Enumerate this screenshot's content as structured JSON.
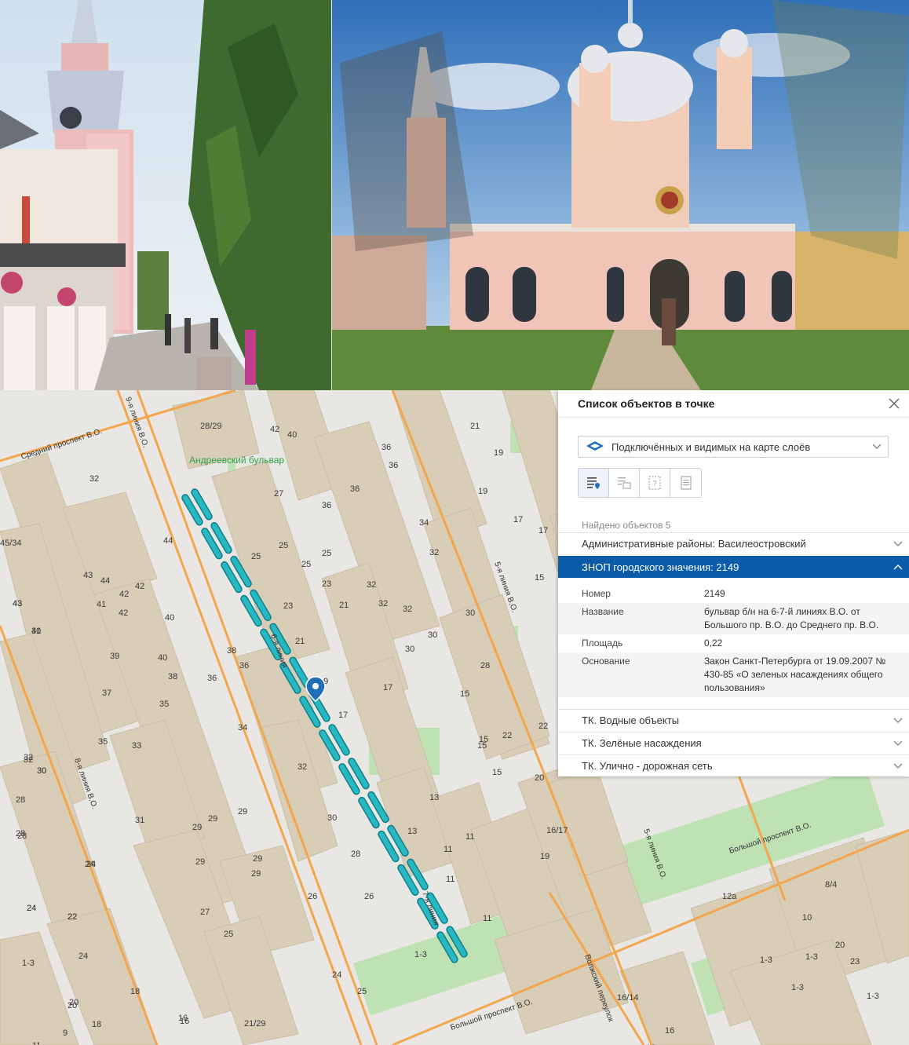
{
  "photos": {
    "left_alt": "street-photo",
    "right_alt": "cathedral-photo"
  },
  "map": {
    "park_label": "Андреевский бульвар",
    "streets": {
      "sredniy": "Средний проспект В.О.",
      "liniya9": "9-я линия В.О.",
      "liniya8": "8-я линия В.О.",
      "liniya5a": "5-я линия В.О.",
      "liniya5b": "5-я линия В.О.",
      "bolshoy1": "Большой проспект В.О.",
      "bolshoy2": "Большой проспект В.О.",
      "volzhskiy": "Волжский переулок",
      "liniya6": "6-я линия",
      "liniya7": "7-я линия"
    },
    "numbers": [
      {
        "t": "28/29"
      },
      {
        "t": "42"
      },
      {
        "t": "40"
      },
      {
        "t": "21"
      },
      {
        "t": "36"
      },
      {
        "t": "36"
      },
      {
        "t": "19"
      },
      {
        "t": "32"
      },
      {
        "t": "27"
      },
      {
        "t": "36"
      },
      {
        "t": "36"
      },
      {
        "t": "19"
      },
      {
        "t": "34"
      },
      {
        "t": "17"
      },
      {
        "t": "17"
      },
      {
        "t": "44"
      },
      {
        "t": "45/34"
      },
      {
        "t": "25"
      },
      {
        "t": "25"
      },
      {
        "t": "25"
      },
      {
        "t": "25"
      },
      {
        "t": "32"
      },
      {
        "t": "43"
      },
      {
        "t": "44"
      },
      {
        "t": "42"
      },
      {
        "t": "42"
      },
      {
        "t": "23"
      },
      {
        "t": "32"
      },
      {
        "t": "15"
      },
      {
        "t": "43"
      },
      {
        "t": "41"
      },
      {
        "t": "42"
      },
      {
        "t": "40"
      },
      {
        "t": "23"
      },
      {
        "t": "21"
      },
      {
        "t": "32"
      },
      {
        "t": "32"
      },
      {
        "t": "30"
      },
      {
        "t": "41"
      },
      {
        "t": "30"
      },
      {
        "t": "21"
      },
      {
        "t": "39"
      },
      {
        "t": "40"
      },
      {
        "t": "38"
      },
      {
        "t": "30"
      },
      {
        "t": "38"
      },
      {
        "t": "36"
      },
      {
        "t": "36"
      },
      {
        "t": "28"
      },
      {
        "t": "37"
      },
      {
        "t": "19"
      },
      {
        "t": "17"
      },
      {
        "t": "15"
      },
      {
        "t": "35"
      },
      {
        "t": "17"
      },
      {
        "t": "34"
      },
      {
        "t": "22"
      },
      {
        "t": "35"
      },
      {
        "t": "33"
      },
      {
        "t": "15"
      },
      {
        "t": "22"
      },
      {
        "t": "32"
      },
      {
        "t": "15"
      },
      {
        "t": "15"
      },
      {
        "t": "20"
      },
      {
        "t": "30"
      },
      {
        "t": "32"
      },
      {
        "t": "13"
      },
      {
        "t": "29"
      },
      {
        "t": "31"
      },
      {
        "t": "29"
      },
      {
        "t": "29"
      },
      {
        "t": "30"
      },
      {
        "t": "13"
      },
      {
        "t": "16/17"
      },
      {
        "t": "28"
      },
      {
        "t": "11"
      },
      {
        "t": "29"
      },
      {
        "t": "29"
      },
      {
        "t": "28"
      },
      {
        "t": "11"
      },
      {
        "t": "19"
      },
      {
        "t": "24"
      },
      {
        "t": "11"
      },
      {
        "t": "29"
      },
      {
        "t": "26"
      },
      {
        "t": "26"
      },
      {
        "t": "24"
      },
      {
        "t": "27"
      },
      {
        "t": "12а"
      },
      {
        "t": "8/4"
      },
      {
        "t": "22"
      },
      {
        "t": "11"
      },
      {
        "t": "10"
      },
      {
        "t": "25"
      },
      {
        "t": "1-3"
      },
      {
        "t": "1-3"
      },
      {
        "t": "20"
      },
      {
        "t": "23"
      },
      {
        "t": "24"
      },
      {
        "t": "1-3"
      },
      {
        "t": "1-3"
      },
      {
        "t": "1-3"
      },
      {
        "t": "24"
      },
      {
        "t": "18"
      },
      {
        "t": "25"
      },
      {
        "t": "16/14"
      },
      {
        "t": "1-3"
      },
      {
        "t": "20"
      },
      {
        "t": "11"
      },
      {
        "t": "9"
      },
      {
        "t": "18"
      },
      {
        "t": "16"
      },
      {
        "t": "21/29"
      },
      {
        "t": "16"
      },
      {
        "t": "16"
      },
      {
        "t": "16"
      },
      {
        "t": "20"
      },
      {
        "t": "22"
      },
      {
        "t": "30"
      },
      {
        "t": "28"
      },
      {
        "t": "24"
      },
      {
        "t": "24"
      },
      {
        "t": "32"
      },
      {
        "t": "30"
      },
      {
        "t": "28"
      },
      {
        "t": "43"
      }
    ]
  },
  "panel": {
    "title": "Список объектов в точке",
    "layer_select": "Подключённых и видимых на карте слоёв",
    "found": "Найдено объектов 5",
    "accordions": [
      {
        "label": "Административные районы: Василеостровский"
      },
      {
        "label": "ЗНОП городского значения: 2149"
      },
      {
        "label": "ТК. Водные объекты"
      },
      {
        "label": "ТК. Зелёные насаждения"
      },
      {
        "label": "ТК. Улично - дорожная сеть"
      }
    ],
    "attributes": [
      {
        "key": "Номер",
        "value": "2149"
      },
      {
        "key": "Название",
        "value": "бульвар б/н на 6-7-й линиях В.О. от Большого пр. В.О. до Среднего пр. В.О."
      },
      {
        "key": "Площадь",
        "value": "0,22"
      },
      {
        "key": "Основание",
        "value": "Закон Санкт-Петербурга от 19.09.2007 № 430-85 «О зеленых насаждениях общего пользования»"
      }
    ]
  },
  "colors": {
    "accent": "#0b5ca8",
    "boulevard": "#27b8c4",
    "road": "#f3a64d",
    "building": "#d8cdb6",
    "green": "#bfe2b5"
  }
}
